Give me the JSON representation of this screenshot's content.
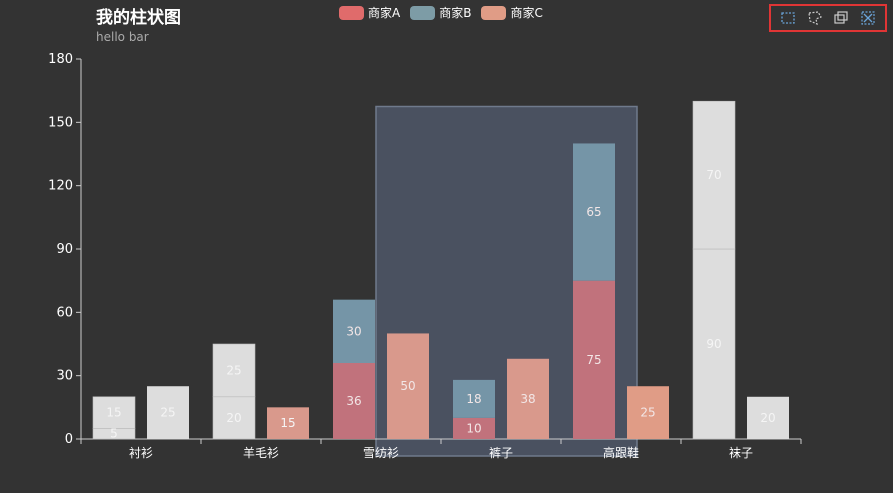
{
  "title": "我的柱状图",
  "subtitle": "hello bar",
  "toolbox_icons": [
    "rect-select-icon",
    "polygon-select-icon",
    "keep-selection-icon",
    "clear-selection-icon"
  ],
  "colors": {
    "background": "#333333",
    "series_A": "#c1727c",
    "series_B": "#7595a7",
    "series_C": "#d9998c",
    "series_C_legend": "#e09c86",
    "inactive": "#dddddd",
    "brush": "#4a5160",
    "toolbox_highlight": "#e03535"
  },
  "chart_data": {
    "type": "bar",
    "title": "我的柱状图",
    "subtitle": "hello bar",
    "categories": [
      "衬衫",
      "羊毛衫",
      "雪纺衫",
      "裤子",
      "高跟鞋",
      "袜子"
    ],
    "series": [
      {
        "name": "商家A",
        "stack": "stack1",
        "values": [
          5,
          20,
          36,
          10,
          75,
          90
        ]
      },
      {
        "name": "商家B",
        "stack": "stack1",
        "values": [
          15,
          25,
          30,
          18,
          65,
          70
        ]
      },
      {
        "name": "商家C",
        "stack": "stack2",
        "values": [
          25,
          15,
          50,
          38,
          25,
          20
        ]
      }
    ],
    "ylim": [
      0,
      180
    ],
    "yticks": [
      0,
      30,
      60,
      90,
      120,
      150,
      180
    ],
    "legend_position": "top-center",
    "grid": false,
    "brush_selected_categories": [
      "雪纺衫",
      "裤子",
      "高跟鞋"
    ]
  }
}
